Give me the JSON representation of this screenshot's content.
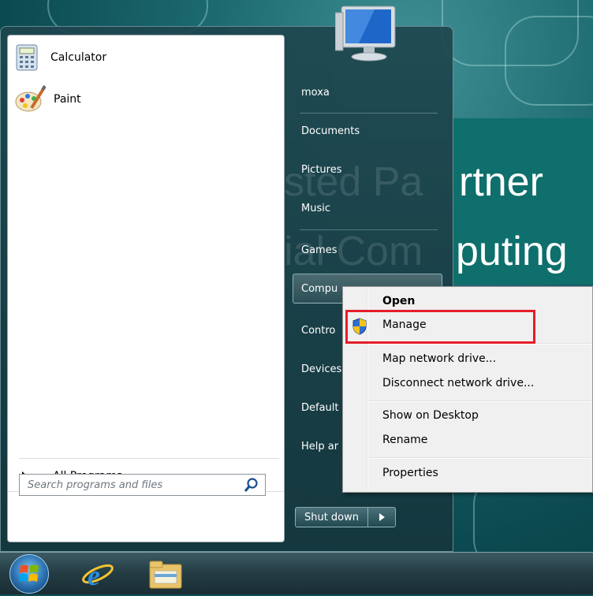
{
  "desktop": {
    "ad_line1": "rtner",
    "ad_line2": "puting",
    "ghost_line1": "sted Pa",
    "ghost_line2": "ial Com"
  },
  "start_menu": {
    "pinned": [
      {
        "label": "Calculator",
        "icon": "calculator-icon"
      },
      {
        "label": "Paint",
        "icon": "paint-icon"
      }
    ],
    "all_programs": "All Programs",
    "search": {
      "placeholder": "Search programs and files",
      "value": ""
    },
    "right_items": [
      {
        "label": "moxa"
      },
      {
        "label": "Documents"
      },
      {
        "label": "Pictures"
      },
      {
        "label": "Music"
      },
      {
        "label": "Games"
      },
      {
        "label": "Compu"
      },
      {
        "label": "Contro"
      },
      {
        "label": "Devices"
      },
      {
        "label": "Default"
      },
      {
        "label": "Help ar"
      }
    ],
    "shutdown_label": "Shut down"
  },
  "context_menu": {
    "items": [
      {
        "label": "Open",
        "bold": true
      },
      {
        "label": "Manage",
        "icon": "uac-shield-icon"
      },
      {
        "label": "Map network drive..."
      },
      {
        "label": "Disconnect network drive..."
      },
      {
        "label": "Show on Desktop"
      },
      {
        "label": "Rename"
      },
      {
        "label": "Properties"
      }
    ]
  },
  "taskbar": {
    "icons": [
      "windows-start-orb-icon",
      "internet-explorer-icon",
      "windows-explorer-icon"
    ]
  },
  "colors": {
    "highlight_box": "#e41e2b",
    "wallpaper_teal": "#0e6f6c"
  }
}
